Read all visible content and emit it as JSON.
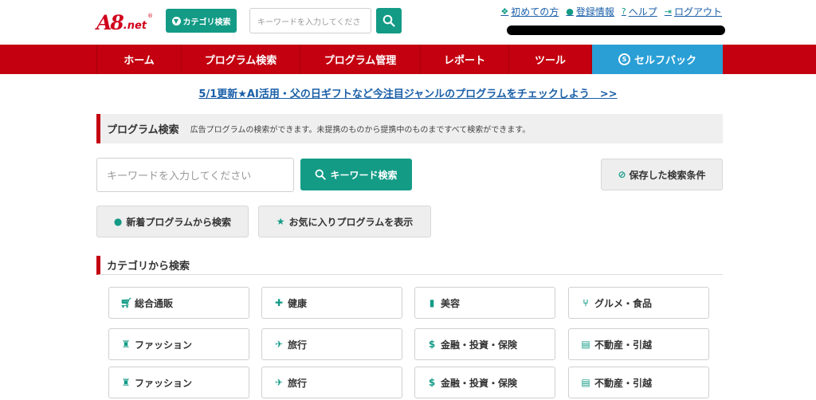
{
  "header": {
    "logo_main": "A8",
    "logo_suffix": ".net",
    "logo_reg": "®",
    "category_button": "カテゴリ検索",
    "search_placeholder": "キーワードを入力してくださ",
    "links": [
      {
        "label": "初めての方",
        "icon": "beginner-mark-icon"
      },
      {
        "label": "登録情報",
        "icon": "person-icon"
      },
      {
        "label": "ヘルプ",
        "icon": "question-icon"
      },
      {
        "label": "ログアウト",
        "icon": "logout-icon"
      }
    ]
  },
  "nav": {
    "items": [
      {
        "label": "ホーム"
      },
      {
        "label": "プログラム検索"
      },
      {
        "label": "プログラム管理"
      },
      {
        "label": "レポート"
      },
      {
        "label": "ツール"
      },
      {
        "label": "セルフバック"
      }
    ]
  },
  "announcement": "5/1更新★AI活用・父の日ギフトなど今注目ジャンルのプログラムをチェックしよう　>>",
  "program_search": {
    "title": "プログラム検索",
    "description": "広告プログラムの検索ができます。未提携のものから提携中のものまですべて検索ができます。",
    "keyword_placeholder": "キーワードを入力してください",
    "keyword_button": "キーワード検索",
    "saved_button": "保存した検索条件",
    "new_button": "新着プログラムから検索",
    "favorite_button": "お気に入りプログラムを表示"
  },
  "category_search": {
    "title": "カテゴリから検索",
    "categories": [
      {
        "label": "総合通販",
        "icon": "cart-icon"
      },
      {
        "label": "健康",
        "icon": "first-aid-icon"
      },
      {
        "label": "美容",
        "icon": "lipstick-icon"
      },
      {
        "label": "グルメ・食品",
        "icon": "fork-knife-icon"
      },
      {
        "label": "ファッション",
        "icon": "shirt-icon"
      },
      {
        "label": "旅行",
        "icon": "airplane-icon"
      },
      {
        "label": "金融・投資・保険",
        "icon": "money-bag-icon"
      },
      {
        "label": "不動産・引越",
        "icon": "shop-icon"
      },
      {
        "label": "ファッション",
        "icon": "shirt-icon"
      },
      {
        "label": "旅行",
        "icon": "airplane-icon"
      },
      {
        "label": "金融・投資・保険",
        "icon": "money-bag-icon"
      },
      {
        "label": "不動産・引越",
        "icon": "shop-icon"
      }
    ]
  },
  "colors": {
    "brand_red": "#c40010",
    "accent_green": "#139b86",
    "selfback_blue": "#2a9fd6",
    "link_blue": "#1a5fa8"
  }
}
